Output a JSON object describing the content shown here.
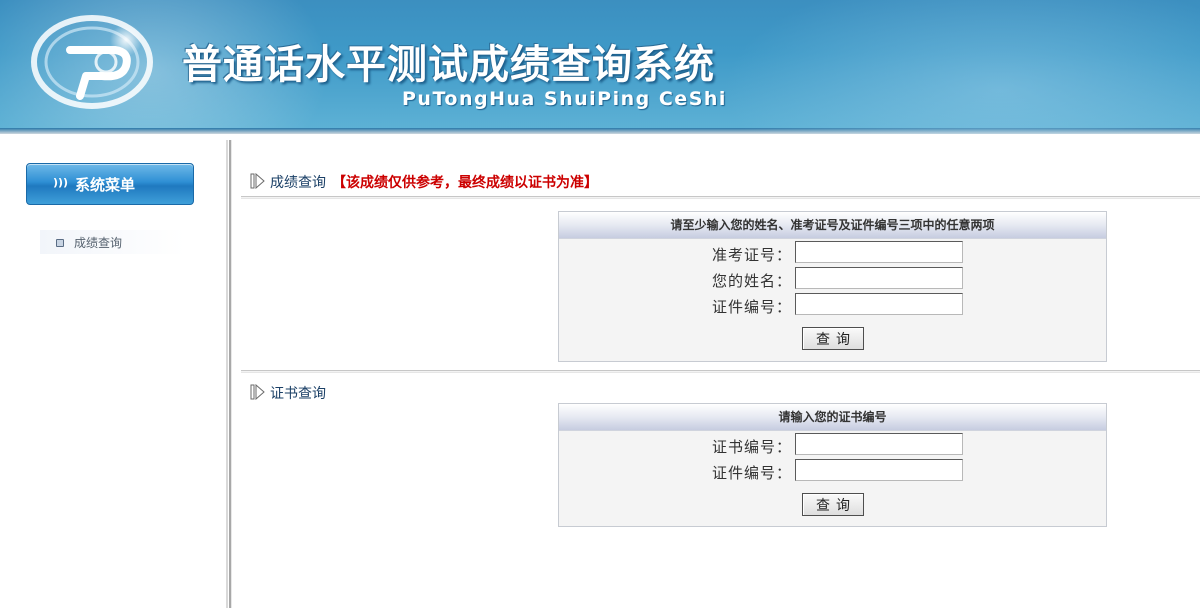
{
  "header": {
    "title_cn": "普通话水平测试成绩查询系统",
    "title_en": "PuTongHua ShuiPing CeShi",
    "logo_icon": "pth-logo-icon"
  },
  "sidebar": {
    "menu_title": "系统菜单",
    "menu_title_icon": "signal-icon",
    "items": [
      {
        "label": "成绩查询",
        "icon": "square-bullet-icon"
      }
    ]
  },
  "score_section": {
    "title": "成绩查询",
    "note": "【该成绩仅供参考，最终成绩以证书为准】",
    "form": {
      "caption": "请至少输入您的姓名、准考证号及证件编号三项中的任意两项",
      "fields": [
        {
          "label": "准考证号：",
          "value": ""
        },
        {
          "label": "您的姓名：",
          "value": ""
        },
        {
          "label": "证件编号：",
          "value": ""
        }
      ],
      "submit_label": "查询"
    }
  },
  "cert_section": {
    "title": "证书查询",
    "form": {
      "caption": "请输入您的证书编号",
      "fields": [
        {
          "label": "证书编号：",
          "value": ""
        },
        {
          "label": "证件编号：",
          "value": ""
        }
      ],
      "submit_label": "查询"
    }
  },
  "colors": {
    "banner": "#3f9ac8",
    "note_red": "#cc0000",
    "section_title": "#1a3f66"
  }
}
